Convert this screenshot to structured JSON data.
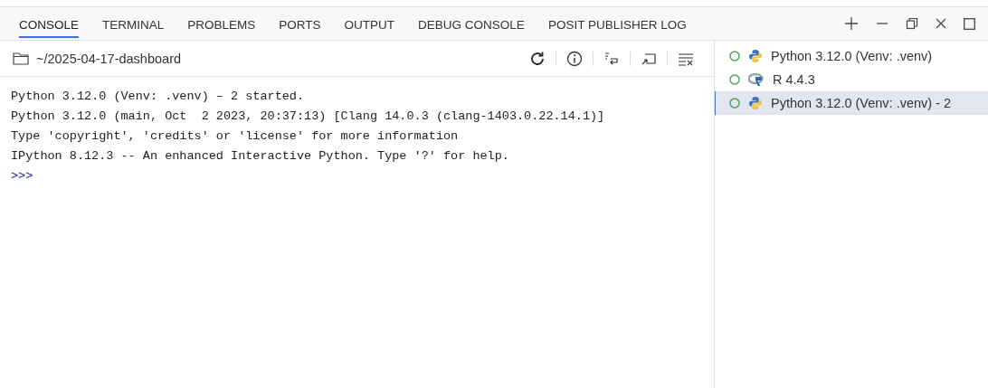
{
  "tabs": [
    {
      "label": "CONSOLE",
      "selected": true
    },
    {
      "label": "TERMINAL",
      "selected": false
    },
    {
      "label": "PROBLEMS",
      "selected": false
    },
    {
      "label": "PORTS",
      "selected": false
    },
    {
      "label": "OUTPUT",
      "selected": false
    },
    {
      "label": "DEBUG CONSOLE",
      "selected": false
    },
    {
      "label": "POSIT PUBLISHER LOG",
      "selected": false
    }
  ],
  "folder": "~/2025-04-17-dashboard",
  "console_lines": [
    "Python 3.12.0 (Venv: .venv) – 2 started.",
    "Python 3.12.0 (main, Oct  2 2023, 20:37:13) [Clang 14.0.3 (clang-1403.0.22.14.1)]",
    "Type 'copyright', 'credits' or 'license' for more information",
    "IPython 8.12.3 -- An enhanced Interactive Python. Type '?' for help."
  ],
  "prompt": ">>>",
  "sessions": [
    {
      "kind": "python",
      "label": "Python 3.12.0 (Venv: .venv)",
      "selected": false
    },
    {
      "kind": "r",
      "label": "R 4.4.3",
      "selected": false
    },
    {
      "kind": "python",
      "label": "Python 3.12.0 (Venv: .venv) - 2",
      "selected": true
    }
  ]
}
